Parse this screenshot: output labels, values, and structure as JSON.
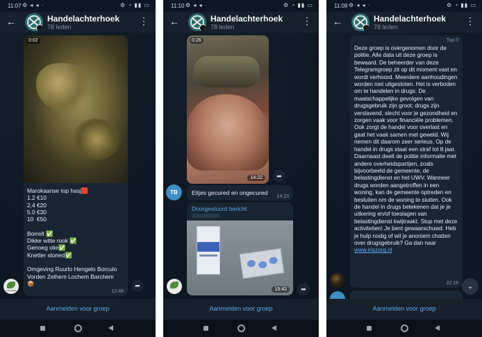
{
  "chat": {
    "title": "Handelachterhoek",
    "members": "78 leden",
    "join_label": "Aanmelden voor groep"
  },
  "icons": {
    "back": "arrow-left-icon",
    "menu": "more-vertical-icon",
    "forward": "share-icon",
    "scroll_down": "chevron-down-icon"
  },
  "colors": {
    "background": "#0e1621",
    "header": "#17212b",
    "bubble": "#182533",
    "accent": "#5fa8e6"
  },
  "screens": [
    {
      "status_time": "11:07",
      "video_duration": "0:02",
      "message_text": "Marokaanse top hasj🟥\n1.2 €10\n2.4 €20\n5.0 €30\n10  €50\n\nBorrelt ✅\nDikke witte rook ✅\nGenoeg olie✅\nKnetter stoned✅\n\nOmgeving Ruurlo Hengelo Borculo Vorden Zelhem Lochem Barchem\n📦",
      "time": "12:48"
    },
    {
      "status_time": "11:10",
      "video_duration": "0:26",
      "video_time": "14:22",
      "sender_initials": "TB",
      "message_text": "Eitjes gecured en ongecured",
      "message_time": "14:23",
      "forwarded_label": "Doorgestuurd bericht",
      "photo_time": "15:42"
    },
    {
      "status_time": "11:08",
      "sender": "Top 0",
      "message_text": "Deze groep is overgenomen door de politie. Alle data uit deze groep is bewaard. De beheerder van deze Telegramgroep zit op dit moment vast en wordt verhoord. Meerdere aanhoudingen worden niet uitgesloten. Het is verboden om te handelen in drugs. De maatschappelijke gevolgen van drugsgebruik zijn groot; drugs zijn verslavend, slecht voor je gezondheid en zorgen vaak voor financiële problemen. Ook zorgt de handel voor overlast en gaat het vaak samen met geweld. Wij nemen dit daarom zeer serieus. Op de handel in drugs staat een straf tot 8 jaar. Daarnaast deelt de politie informatie met andere overheidspartijen, zoals bijvoorbeeld de gemeente, de belastingdienst en het UWV. Wanneer drugs worden aangetroffen in een woning, kan de gemeente optreden en besluiten om de woning te sluiten. Ook de handel in drugs betekenen dat je je uitkering en/of toeslagen van belastingdienst kwijtraakt. Stop met deze activiteiten! Je bent gewaarschuwd. Heb je hulp nodig of wil je anoniem chatten over drugsgebruik? Ga dan naar",
      "link_text": "www.iriszorg.nl",
      "time": "22:19"
    }
  ]
}
